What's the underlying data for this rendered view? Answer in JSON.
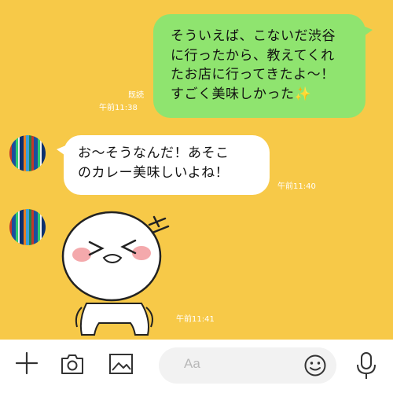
{
  "messages": {
    "sent": {
      "lines": [
        "そういえば、こないだ渋谷",
        "に行ったから、教えてくれ",
        "たお店に行ってきたよ〜！",
        "すごく美味しかった"
      ],
      "emoji": "✨",
      "read": "既読",
      "time": "午前11:38"
    },
    "received": {
      "lines": [
        "お〜そうなんだ！あそこ",
        "のカレー美味しいよね！"
      ],
      "time": "午前11:40"
    },
    "sticker": {
      "time": "午前11:41"
    }
  },
  "input": {
    "placeholder": "Aa"
  },
  "icons": {
    "plus": "plus-icon",
    "camera": "camera-icon",
    "image": "image-icon",
    "emoji": "smiley-icon",
    "mic": "microphone-icon"
  },
  "colors": {
    "background": "#f7c948",
    "sent_bubble": "#8fe46f",
    "received_bubble": "#ffffff"
  }
}
